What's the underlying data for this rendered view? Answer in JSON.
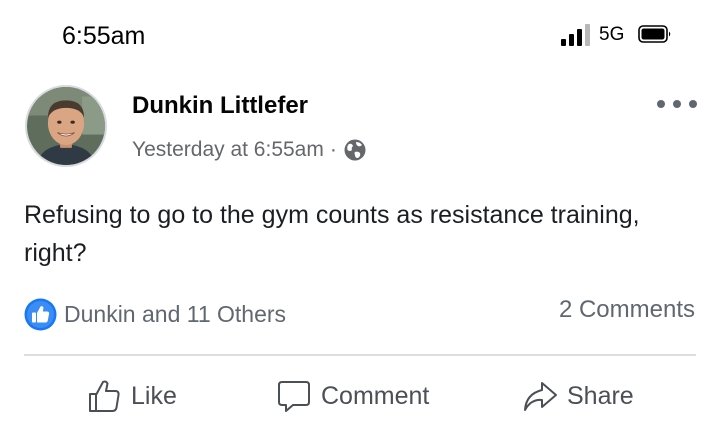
{
  "status_bar": {
    "time": "6:55am",
    "network": "5G",
    "icons": [
      "signal-icon",
      "battery-icon"
    ]
  },
  "post": {
    "author": "Dunkin Littlefer",
    "timestamp": "Yesterday at 6:55am",
    "separator": "·",
    "privacy_icon": "globe-icon",
    "text": "Refusing to go to the gym counts as resistance training, right?",
    "reactions_text": "Dunkin and 11 Others",
    "comments_count": "2 Comments"
  },
  "actions": {
    "like": "Like",
    "comment": "Comment",
    "share": "Share"
  },
  "colors": {
    "like_blue": "#1877f2",
    "secondary_text": "#65676b",
    "divider": "#dadde1"
  }
}
